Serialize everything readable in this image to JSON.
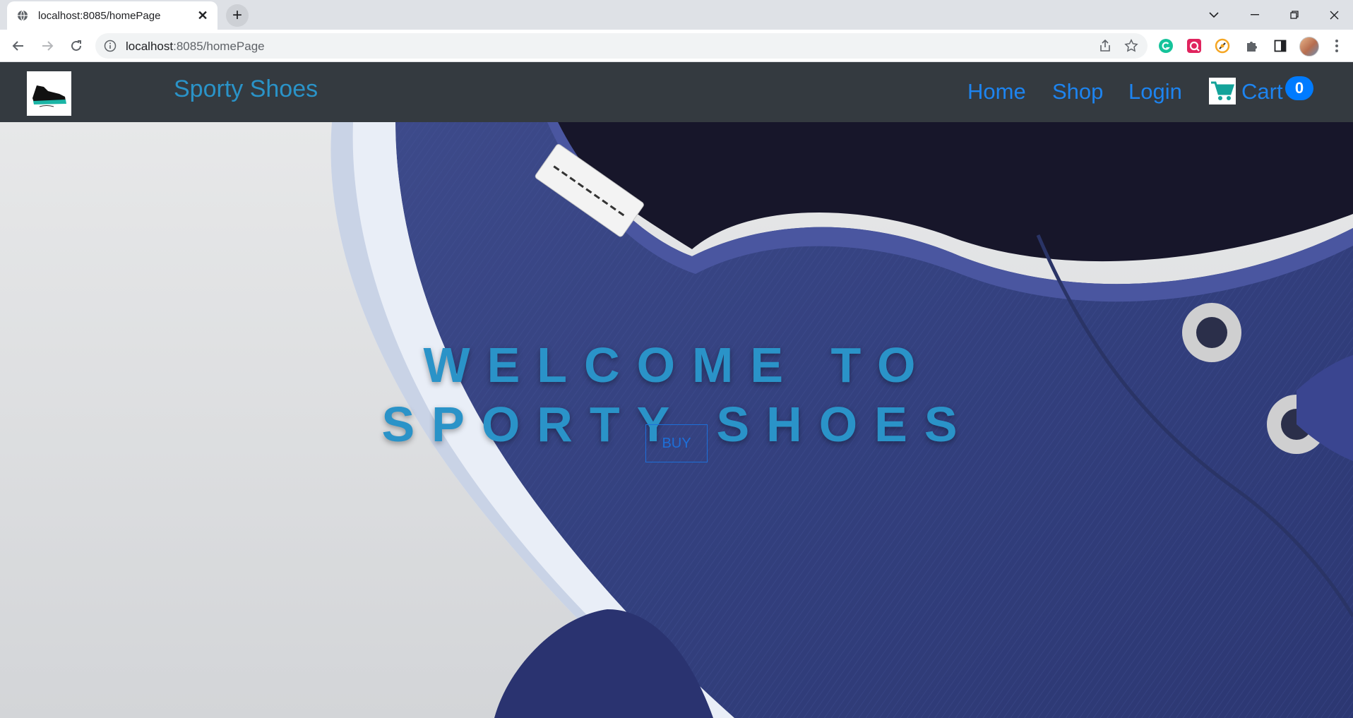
{
  "browser": {
    "tab_title": "localhost:8085/homePage",
    "url_host": "localhost",
    "url_rest": ":8085/homePage",
    "icons": {
      "tab_favicon": "globe-icon",
      "tab_close": "close-icon",
      "new_tab": "plus-icon",
      "back": "arrow-left-icon",
      "forward": "arrow-right-icon",
      "reload": "reload-icon",
      "site_info": "info-icon",
      "share": "share-icon",
      "bookmark": "star-icon",
      "extensions": [
        "grammarly-icon",
        "red-extension-icon",
        "orange-extension-icon",
        "puzzle-icon",
        "side-panel-icon"
      ],
      "profile": "avatar",
      "menu": "kebab-menu-icon"
    }
  },
  "navbar": {
    "brand": "Sporty Shoes",
    "links": [
      "Home",
      "Shop",
      "Login"
    ],
    "cart_label": "Cart",
    "cart_count": "0"
  },
  "hero": {
    "title": "Welcome to Sporty Shoes",
    "button": "BUY"
  },
  "colors": {
    "navbar_bg": "#343a40",
    "brand_text": "#2a93c8",
    "link_text": "#1d84f0",
    "badge_bg": "#007bff",
    "hero_title": "#2a93c8"
  }
}
